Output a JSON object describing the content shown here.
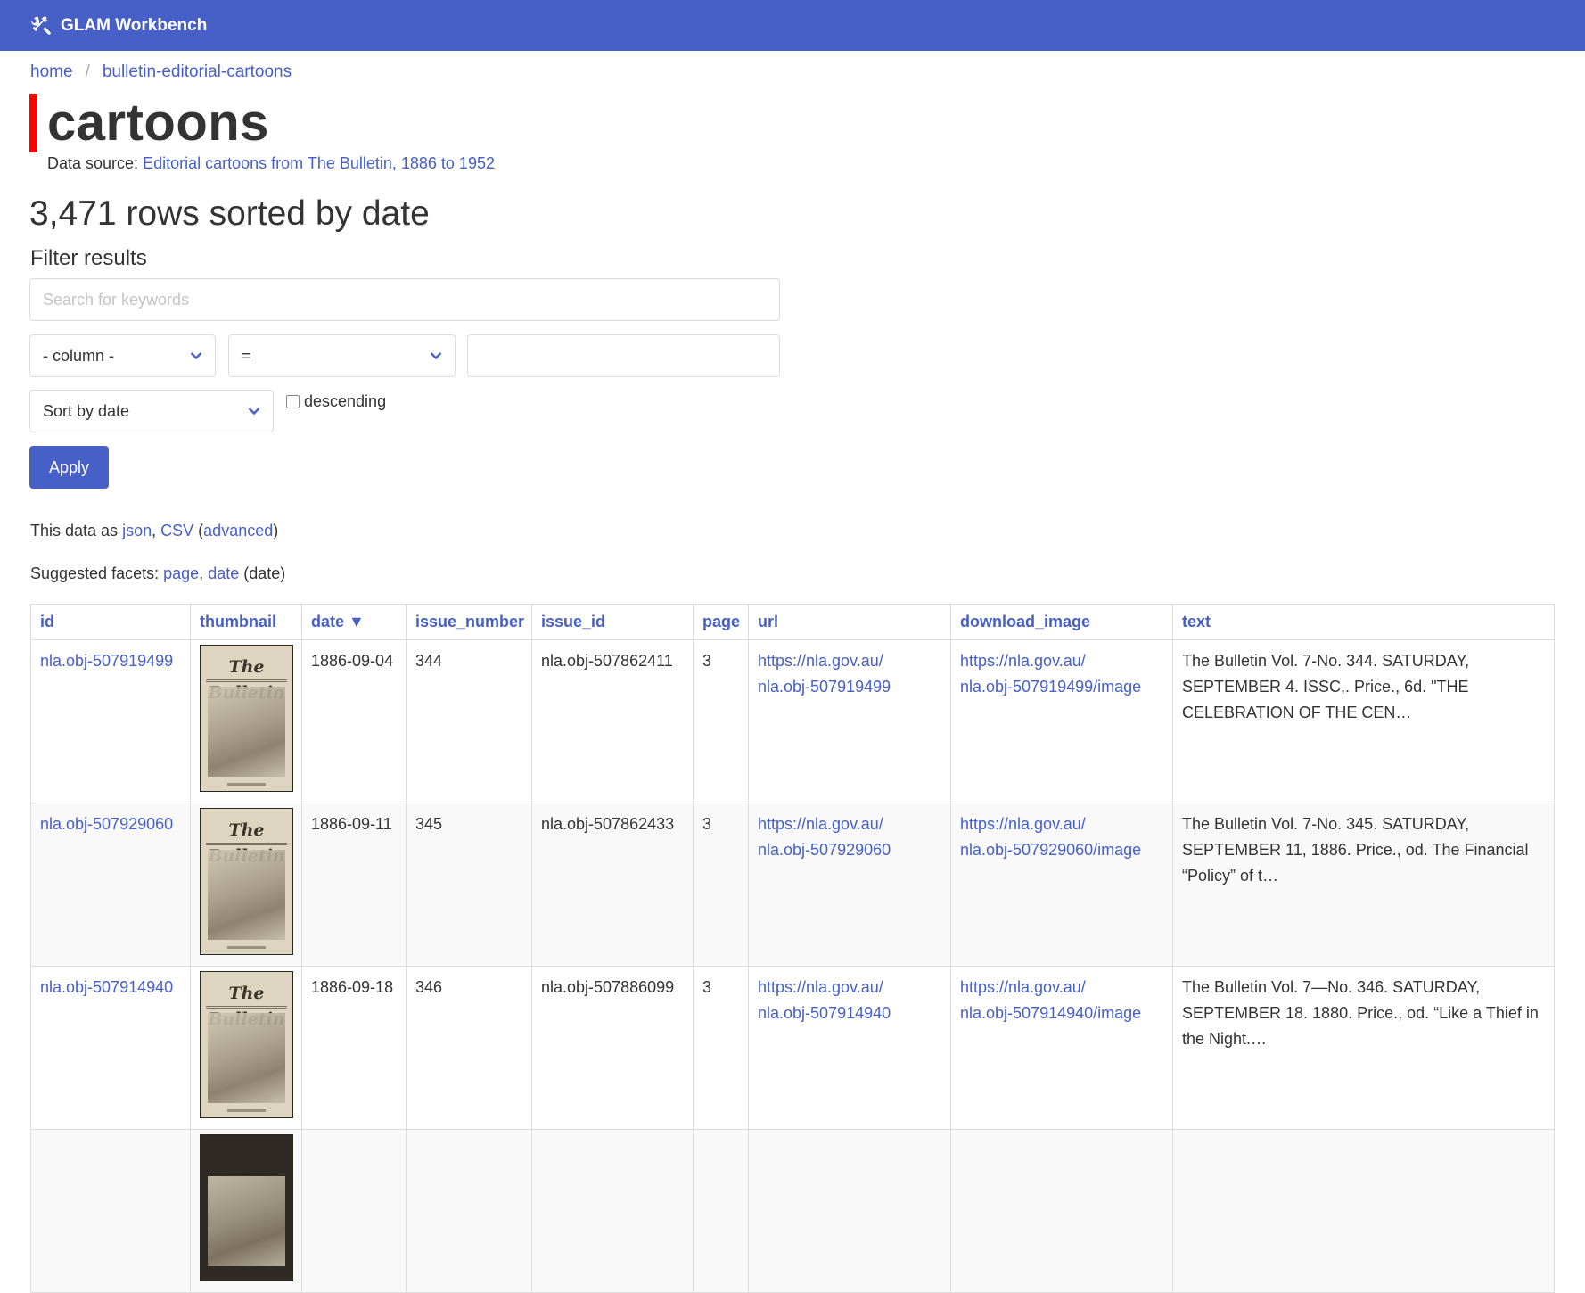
{
  "topbar": {
    "brand": "GLAM Workbench",
    "brand_icon": "tools-icon",
    "color": "#4760c8"
  },
  "breadcrumb": {
    "home": "home",
    "separator": "/",
    "database": "bulletin-editorial-cartoons"
  },
  "page": {
    "title": "cartoons",
    "accent_color": "#ff0000",
    "source_label": "Data source:",
    "source_link": "Editorial cartoons from The Bulletin, 1886 to 1952",
    "rows_title": "3,471 rows sorted by date"
  },
  "filters": {
    "heading": "Filter results",
    "search_placeholder": "Search for keywords",
    "search_value": "",
    "column_select": "- column -",
    "operator_select": "=",
    "value_input": "",
    "sort_select": "Sort by date",
    "descending_label": "descending",
    "descending_checked": false,
    "apply_label": "Apply"
  },
  "export": {
    "prefix": "This data as",
    "json": "json",
    "comma": ",",
    "csv": "CSV",
    "open_paren": "(",
    "advanced": "advanced",
    "close_paren": ")"
  },
  "facets": {
    "prefix": "Suggested facets:",
    "items": [
      "page",
      "date"
    ],
    "comma": ",",
    "date_suffix": "(date)"
  },
  "table": {
    "columns": [
      "id",
      "thumbnail",
      "date ▼",
      "issue_number",
      "issue_id",
      "page",
      "url",
      "download_image",
      "text"
    ],
    "sorted_column": "date",
    "sort_direction": "descending-indicator",
    "rows": [
      {
        "id": "nla.obj-507919499",
        "thumbnail_masthead": "The Bulletin",
        "date": "1886-09-04",
        "issue_number": "344",
        "issue_id": "nla.obj-507862411",
        "page": "3",
        "url_line1": "https://nla.gov.au/",
        "url_line2": "nla.obj-507919499",
        "download_line1": "https://nla.gov.au/",
        "download_line2": "nla.obj-507919499/image",
        "text": "The Bulletin Vol. 7-No. 344. SATURDAY, SEPTEMBER 4. ISSC,. Price., 6d. \"THE CELEBRATION OF THE CEN…"
      },
      {
        "id": "nla.obj-507929060",
        "thumbnail_masthead": "The Bulletin",
        "date": "1886-09-11",
        "issue_number": "345",
        "issue_id": "nla.obj-507862433",
        "page": "3",
        "url_line1": "https://nla.gov.au/",
        "url_line2": "nla.obj-507929060",
        "download_line1": "https://nla.gov.au/",
        "download_line2": "nla.obj-507929060/image",
        "text": "The Bulletin Vol. 7-No. 345. SATURDAY, SEPTEMBER 11, 1886. Price., od. The Financial “Policy” of t…"
      },
      {
        "id": "nla.obj-507914940",
        "thumbnail_masthead": "The Bulletin",
        "date": "1886-09-18",
        "issue_number": "346",
        "issue_id": "nla.obj-507886099",
        "page": "3",
        "url_line1": "https://nla.gov.au/",
        "url_line2": "nla.obj-507914940",
        "download_line1": "https://nla.gov.au/",
        "download_line2": "nla.obj-507914940/image",
        "text": "The Bulletin Vol. 7—No. 346. SATURDAY, SEPTEMBER 18. 1880. Price., od. “Like a Thief in the Night.…"
      },
      {
        "id": "",
        "thumbnail_masthead": "",
        "date": "",
        "issue_number": "",
        "issue_id": "",
        "page": "",
        "url_line1": "",
        "url_line2": "",
        "download_line1": "",
        "download_line2": "",
        "text": ""
      }
    ]
  }
}
